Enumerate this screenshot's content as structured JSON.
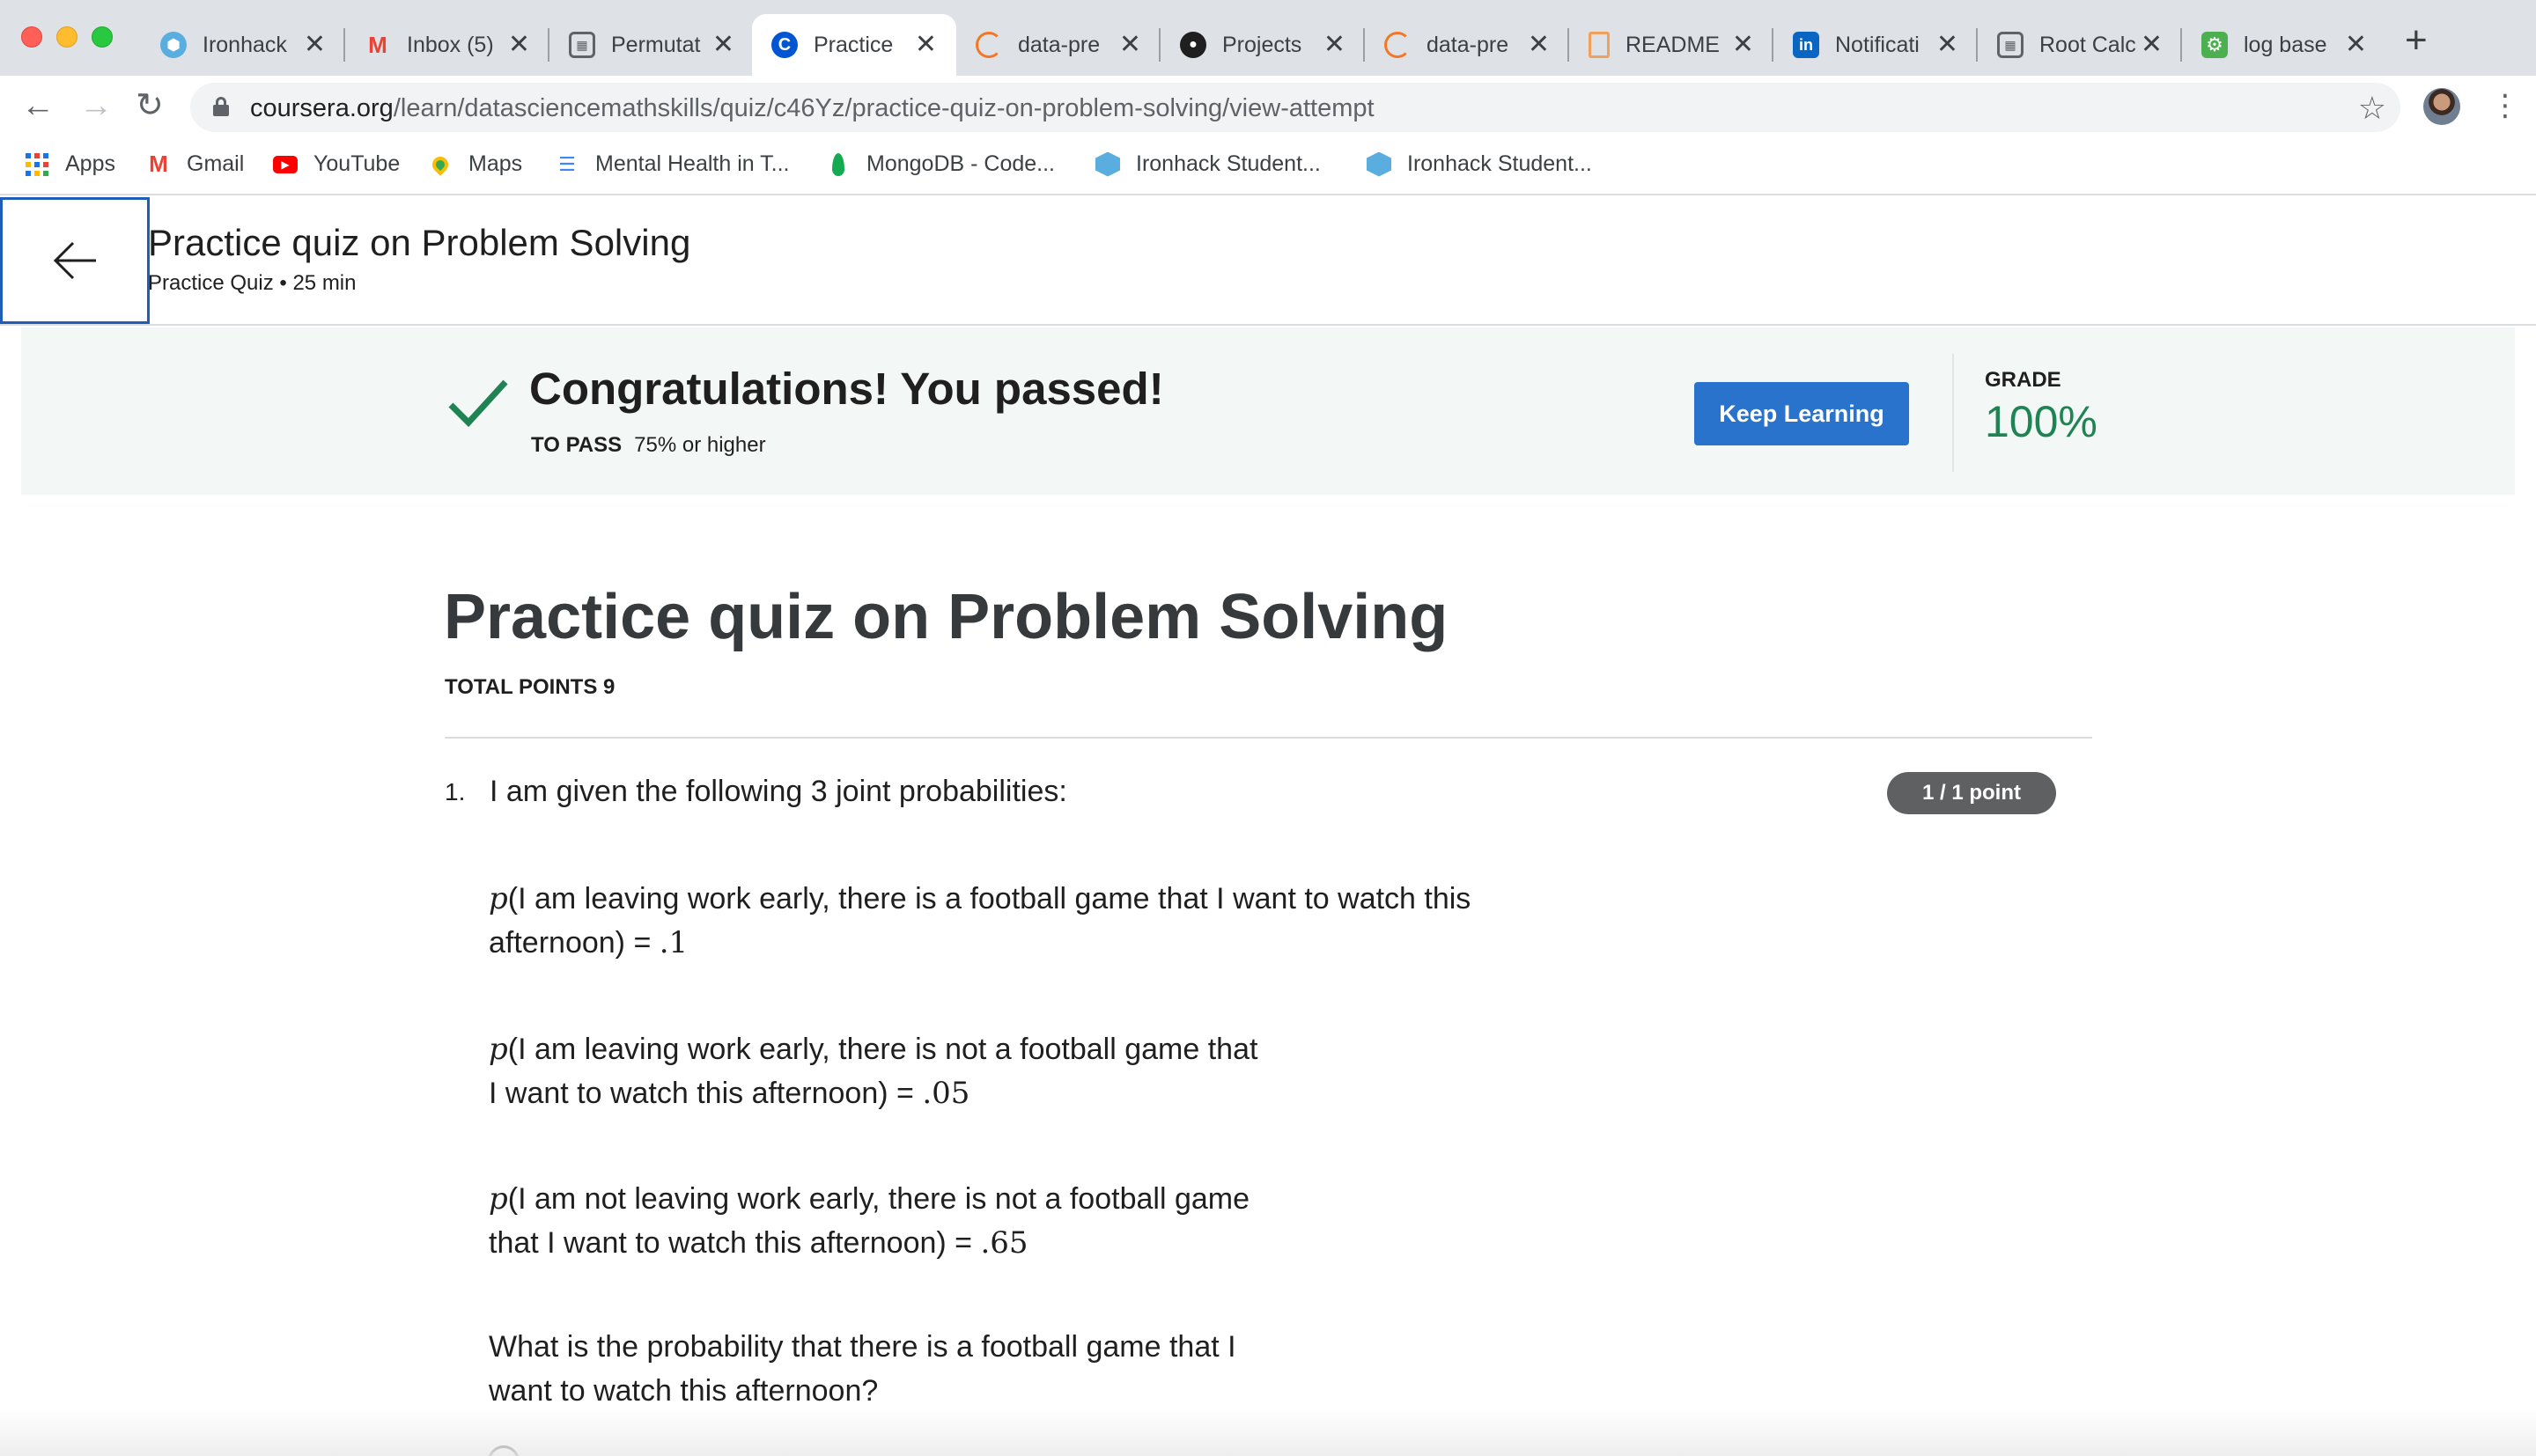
{
  "browser": {
    "tabs": [
      {
        "title": "Ironhack",
        "icon": "ironhack-icon",
        "color": "#5aaedf"
      },
      {
        "title": "Inbox (5)",
        "icon": "gmail-icon",
        "color": "#ea4335"
      },
      {
        "title": "Permutat",
        "icon": "calculator-icon",
        "color": "#5f6368"
      },
      {
        "title": "Practice",
        "icon": "coursera-icon",
        "color": "#0056d2"
      },
      {
        "title": "data-pre",
        "icon": "jupyter-icon",
        "color": "#f37726"
      },
      {
        "title": "Projects",
        "icon": "github-icon",
        "color": "#1f1f1f"
      },
      {
        "title": "data-pre",
        "icon": "jupyter-icon",
        "color": "#f37726"
      },
      {
        "title": "README",
        "icon": "file-icon",
        "color": "#f0a05a"
      },
      {
        "title": "Notificati",
        "icon": "linkedin-icon",
        "color": "#0a66c2"
      },
      {
        "title": "Root Calc",
        "icon": "calculator-icon",
        "color": "#5f6368"
      },
      {
        "title": "log base",
        "icon": "gear-icon",
        "color": "#4caf50"
      }
    ],
    "active_tab": 3,
    "url_host": "coursera.org",
    "url_path": "/learn/datasciencemathskills/quiz/c46Yz/practice-quiz-on-problem-solving/view-attempt",
    "bookmarks": [
      {
        "label": "Apps",
        "icon": "apps-grid-icon"
      },
      {
        "label": "Gmail",
        "icon": "gmail-icon"
      },
      {
        "label": "YouTube",
        "icon": "youtube-icon"
      },
      {
        "label": "Maps",
        "icon": "maps-icon"
      },
      {
        "label": "Mental Health in T...",
        "icon": "bookmark-icon"
      },
      {
        "label": "MongoDB - Code...",
        "icon": "mongodb-icon"
      },
      {
        "label": "Ironhack Student...",
        "icon": "ironhack-icon"
      },
      {
        "label": "Ironhack Student...",
        "icon": "ironhack-icon"
      }
    ]
  },
  "header": {
    "title": "Practice quiz on Problem Solving",
    "subtitle": "Practice Quiz • 25 min"
  },
  "result": {
    "message": "Congratulations! You passed!",
    "to_pass_label": "TO PASS",
    "to_pass_value": "75% or higher",
    "button_label": "Keep Learning",
    "grade_label": "GRADE",
    "grade_value": "100%",
    "accent_color": "#1f8354",
    "button_color": "#2a73cc"
  },
  "quiz": {
    "title": "Practice quiz on Problem Solving",
    "total_points": "TOTAL POINTS 9",
    "question": {
      "number": "1.",
      "text": "I am given the following 3 joint probabilities:",
      "points": "1 / 1 point",
      "p_symbol": "p",
      "statements": [
        {
          "line1": "(I am leaving work early, there is a football game that I want to watch this",
          "line2": "afternoon) = ",
          "value": ".1"
        },
        {
          "line1": "(I am leaving work early, there is not a football game that",
          "line2": "I want to watch this afternoon) = ",
          "value": ".05"
        },
        {
          "line1": "(I am not leaving work early, there is not a football game",
          "line2": "that I want to watch this afternoon) = ",
          "value": ".65"
        }
      ],
      "prompt_line1": "What is the probability that there is a football game that I",
      "prompt_line2": "want to watch this afternoon?"
    }
  }
}
